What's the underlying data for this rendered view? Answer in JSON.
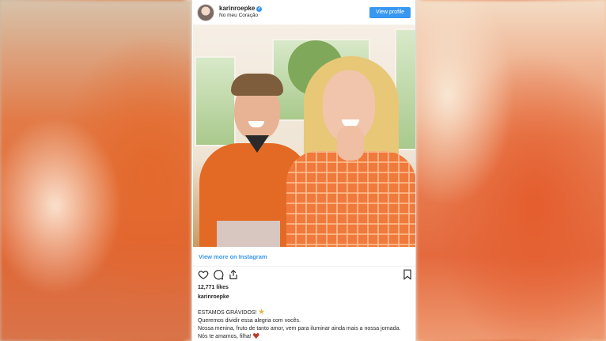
{
  "post": {
    "username": "karinroepke",
    "location": "No meu Coração",
    "view_profile_label": "View profile",
    "view_more_label": "View more on Instagram",
    "likes": "12,771 likes",
    "caption_author": "karinroepke",
    "caption_lines": [
      "ESTAMOS GRÁVIDOS!",
      "Queremos dividir essa alegria com vocês.",
      "Nossa menina, fruto de tanto amor, vem para iluminar ainda mais a nossa jornada.",
      "Nós te amamos, filha!"
    ]
  },
  "icons": {
    "verified": "verified-badge-icon",
    "like": "heart-icon",
    "comment": "comment-icon",
    "share": "share-icon",
    "save": "bookmark-icon",
    "star": "star-emoji",
    "heart_emoji": "red-heart-emoji"
  },
  "colors": {
    "accent": "#3897f0",
    "text": "#262626"
  }
}
